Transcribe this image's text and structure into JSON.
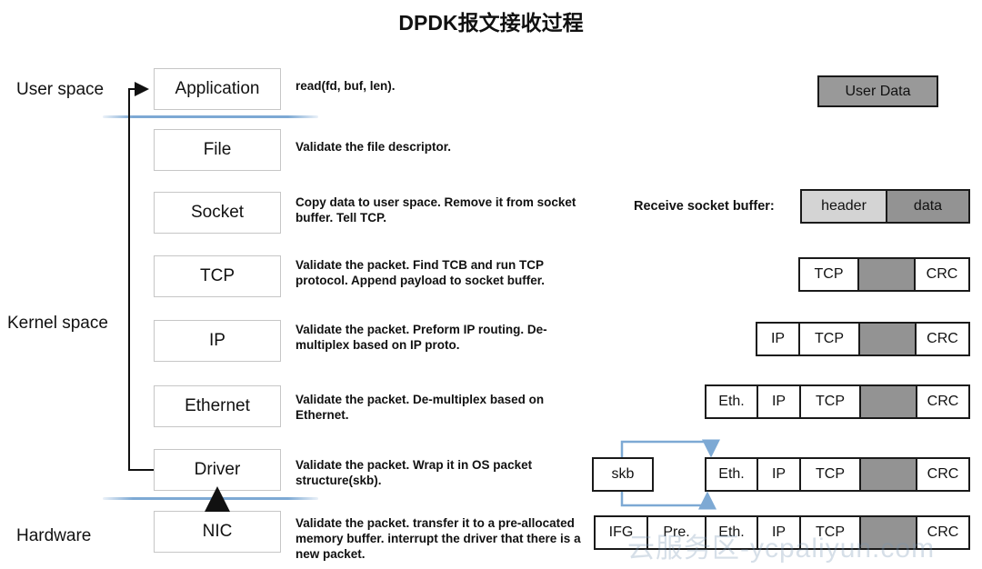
{
  "title": "DPDK报文接收过程",
  "watermark": "云服务区-ycpaliyun.com",
  "zones": [
    {
      "label": "User space"
    },
    {
      "label": "Kernel space"
    },
    {
      "label": "Hardware"
    }
  ],
  "stack": [
    {
      "name": "Application",
      "desc": "read(fd, buf, len)."
    },
    {
      "name": "File",
      "desc": "Validate the file descriptor."
    },
    {
      "name": "Socket",
      "desc": "Copy data to user space. Remove it from socket buffer. Tell TCP."
    },
    {
      "name": "TCP",
      "desc": "Validate the packet. Find TCB and run TCP protocol. Append payload to socket buffer."
    },
    {
      "name": "IP",
      "desc": "Validate the packet. Preform IP routing. De-multiplex based on IP proto."
    },
    {
      "name": "Ethernet",
      "desc": "Validate the packet. De-multiplex based on Ethernet."
    },
    {
      "name": "Driver",
      "desc": "Validate the packet. Wrap it in OS packet structure(skb)."
    },
    {
      "name": "NIC",
      "desc": "Validate the packet. transfer it to a pre-allocated memory buffer. interrupt the driver that there is a new packet."
    }
  ],
  "right": {
    "user_data_label": "User Data",
    "socket_buffer_label": "Receive socket buffer:",
    "socket_buffer_cells": [
      {
        "text": "header",
        "fill": "light"
      },
      {
        "text": "data",
        "fill": "dark"
      }
    ],
    "skb_label": "skb",
    "packets": [
      {
        "row": "tcp",
        "cells": [
          {
            "text": "TCP",
            "fill": "white"
          },
          {
            "text": "",
            "fill": "payload"
          },
          {
            "text": "CRC",
            "fill": "white"
          }
        ]
      },
      {
        "row": "ip",
        "cells": [
          {
            "text": "IP",
            "fill": "white"
          },
          {
            "text": "TCP",
            "fill": "white"
          },
          {
            "text": "",
            "fill": "payload"
          },
          {
            "text": "CRC",
            "fill": "white"
          }
        ]
      },
      {
        "row": "ethernet",
        "cells": [
          {
            "text": "Eth.",
            "fill": "white"
          },
          {
            "text": "IP",
            "fill": "white"
          },
          {
            "text": "TCP",
            "fill": "white"
          },
          {
            "text": "",
            "fill": "payload"
          },
          {
            "text": "CRC",
            "fill": "white"
          }
        ]
      },
      {
        "row": "driver",
        "cells": [
          {
            "text": "Eth.",
            "fill": "white"
          },
          {
            "text": "IP",
            "fill": "white"
          },
          {
            "text": "TCP",
            "fill": "white"
          },
          {
            "text": "",
            "fill": "payload"
          },
          {
            "text": "CRC",
            "fill": "white"
          }
        ]
      },
      {
        "row": "nic",
        "cells": [
          {
            "text": "IFG",
            "fill": "white"
          },
          {
            "text": "Pre.",
            "fill": "white"
          },
          {
            "text": "Eth.",
            "fill": "white"
          },
          {
            "text": "IP",
            "fill": "white"
          },
          {
            "text": "TCP",
            "fill": "white"
          },
          {
            "text": "",
            "fill": "payload"
          },
          {
            "text": "CRC",
            "fill": "white"
          }
        ]
      }
    ]
  },
  "colors": {
    "divider_blue": "#7da9d4",
    "payload_grey": "#939393",
    "header_light": "#d4d4d4",
    "user_data_grey": "#999999",
    "box_border": "#c6c6c6",
    "packet_border": "#1a1a1a",
    "text": "#111111"
  }
}
